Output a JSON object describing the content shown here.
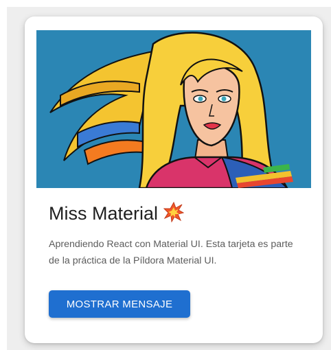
{
  "card": {
    "title": "Miss Material",
    "title_emoji_icon": "collision-icon",
    "description": "Aprendiendo React con Material UI. Esta tarjeta es parte de la práctica de la Píldora Material UI.",
    "action_label": "MOSTRAR MENSAJE",
    "image_icon": "pop-art-heroine-illustration"
  },
  "colors": {
    "button": "#1f6fd0",
    "image_background": "#2b86b4",
    "title": "#1f1f1f",
    "description": "#5c5c5c"
  }
}
